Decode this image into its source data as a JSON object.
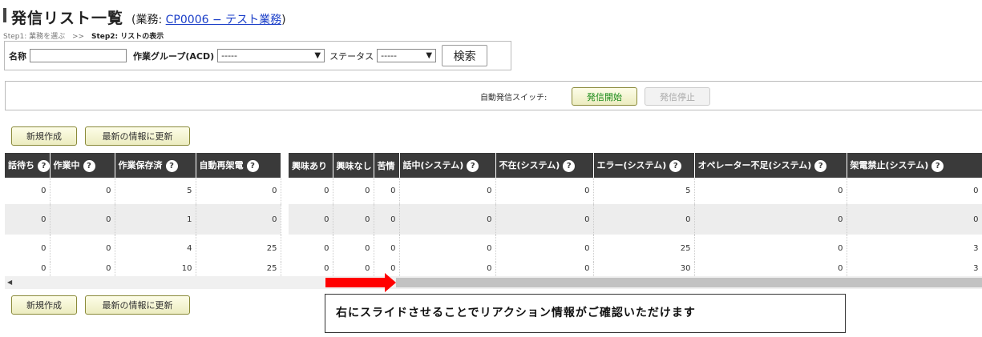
{
  "header": {
    "title": "発信リスト一覧",
    "business_prefix": "(業務: ",
    "business_link": "CP0006 − テスト業務",
    "business_suffix": ")"
  },
  "steps": {
    "step1": "Step1: 業務を選ぶ",
    "arrow": ">>",
    "step2": "Step2: リストの表示"
  },
  "search": {
    "name_label": "名称",
    "name_value": "",
    "group_label": "作業グループ(ACD)",
    "group_selected": "-----",
    "status_label": "ステータス",
    "status_selected": "-----",
    "search_button": "検索"
  },
  "auto_switch": {
    "label": "自動発信スイッチ:",
    "start_button": "発信開始",
    "stop_button": "発信停止"
  },
  "actions": {
    "new_button": "新規作成",
    "refresh_button": "最新の情報に更新"
  },
  "table": {
    "columns": [
      "話待ち",
      "作業中",
      "作業保存済",
      "自動再架電",
      "",
      "興味あり",
      "興味なし",
      "苦情",
      "話中(システム)",
      "不在(システム)",
      "エラー(システム)",
      "オペレーター不足(システム)",
      "架電禁止(システム)"
    ],
    "help_glyph": "?",
    "rows": [
      [
        "0",
        "0",
        "5",
        "0",
        "",
        "0",
        "0",
        "0",
        "0",
        "0",
        "5",
        "0",
        "0"
      ],
      [
        "0",
        "0",
        "1",
        "0",
        "",
        "0",
        "0",
        "0",
        "0",
        "0",
        "0",
        "0",
        "0"
      ],
      [
        "0",
        "0",
        "4",
        "25",
        "",
        "0",
        "0",
        "0",
        "0",
        "0",
        "25",
        "0",
        "3"
      ],
      [
        "0",
        "0",
        "10",
        "25",
        "",
        "0",
        "0",
        "0",
        "0",
        "0",
        "30",
        "0",
        "3"
      ]
    ]
  },
  "scrollbar": {
    "left_arrow": "◀"
  },
  "annotation": {
    "text": "右にスライドさせることでリアクション情報がご確認いただけます",
    "arrow_color": "#ff0000"
  },
  "colors": {
    "header_bg": "#3a3a3a",
    "link": "#1a3ec8",
    "start_text": "#1a8a1a"
  }
}
